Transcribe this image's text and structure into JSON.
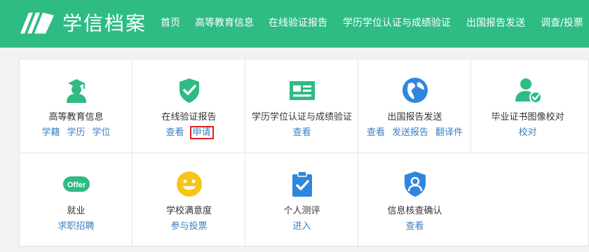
{
  "header": {
    "brand": "学信档案",
    "nav": [
      "首页",
      "高等教育信息",
      "在线验证报告",
      "学历学位认证与成绩验证",
      "出国报告发送",
      "调查/投票"
    ]
  },
  "colors": {
    "header_bg": "#2fbb84",
    "link": "#3a7fc4",
    "highlight_box": "#e02020",
    "icon_green": "#2fbb84",
    "icon_blue": "#2e86de",
    "icon_yellow": "#f5c518"
  },
  "cards": [
    {
      "icon": "graduate-icon",
      "title": "高等教育信息",
      "links": [
        "学籍",
        "学历",
        "学位"
      ]
    },
    {
      "icon": "shield-check-icon",
      "title": "在线验证报告",
      "links": [
        "查看",
        "申请"
      ],
      "highlighted_link": "申请"
    },
    {
      "icon": "id-card-icon",
      "title": "学历学位认证与成绩验证",
      "links": [
        "查看"
      ]
    },
    {
      "icon": "globe-icon",
      "title": "出国报告发送",
      "links": [
        "查看",
        "发送报告",
        "翻译件"
      ]
    },
    {
      "icon": "user-check-icon",
      "title": "毕业证书图像校对",
      "links": [
        "校对"
      ]
    },
    {
      "icon": "offer-icon",
      "icon_text": "Offer",
      "title": "就业",
      "links": [
        "求职招聘"
      ]
    },
    {
      "icon": "smiley-icon",
      "title": "学校满意度",
      "links": [
        "参与投票"
      ]
    },
    {
      "icon": "clipboard-check-icon",
      "title": "个人测评",
      "links": [
        "进入"
      ]
    },
    {
      "icon": "person-shield-icon",
      "title": "信息核查确认",
      "links": [
        "查看"
      ]
    }
  ]
}
